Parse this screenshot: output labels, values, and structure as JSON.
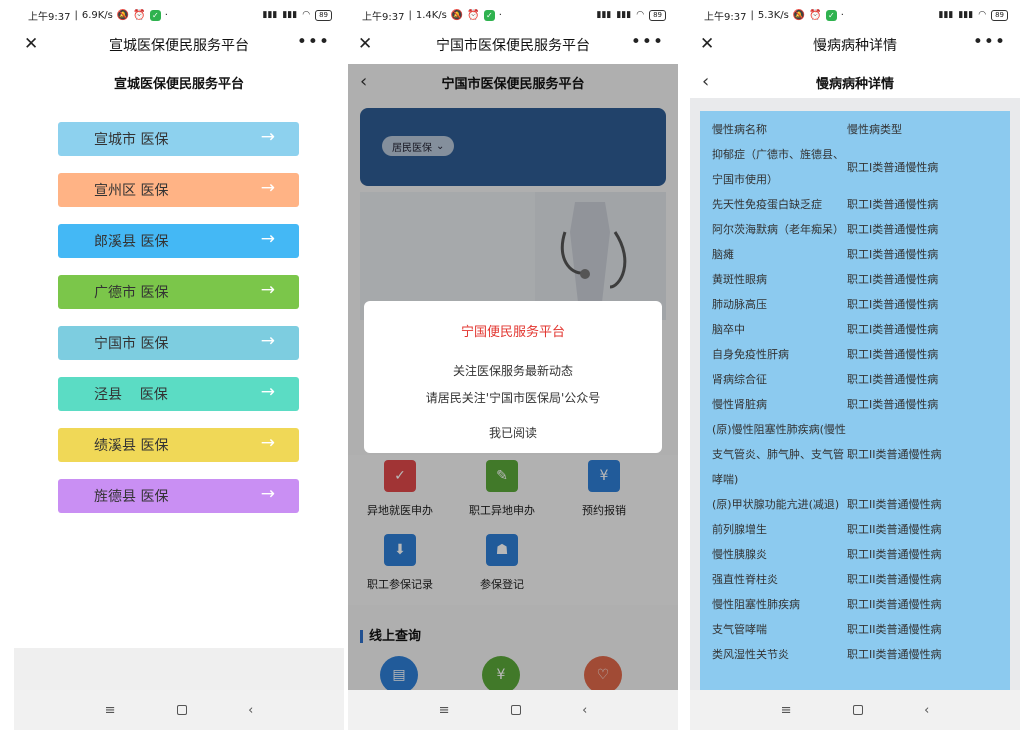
{
  "status": [
    {
      "time": "上午9:37",
      "speed": "6.9K/s",
      "battery": "89"
    },
    {
      "time": "上午9:37",
      "speed": "1.4K/s",
      "battery": "89"
    },
    {
      "time": "上午9:37",
      "speed": "5.3K/s",
      "battery": "89"
    }
  ],
  "panel1": {
    "title": "宣城医保便民服务平台",
    "subtitle": "宣城医保便民服务平台",
    "buttons": [
      {
        "label": "宣城市 医保",
        "color": "#8dd1ee"
      },
      {
        "label": "宣州区 医保",
        "color": "#ffb385"
      },
      {
        "label": "郎溪县 医保",
        "color": "#44b8f5"
      },
      {
        "label": "广德市 医保",
        "color": "#7bc64a"
      },
      {
        "label": "宁国市 医保",
        "color": "#7dcde0"
      },
      {
        "label": "泾县    医保",
        "color": "#5bdcc4"
      },
      {
        "label": "绩溪县 医保",
        "color": "#f0d857"
      },
      {
        "label": "旌德县 医保",
        "color": "#c98ff3"
      }
    ]
  },
  "panel2": {
    "title": "宁国市医保便民服务平台",
    "subtitle": "宁国市医保便民服务平台",
    "pill": "居民医保",
    "dialog": {
      "title": "宁国便民服务平台",
      "line1": "关注医保服务最新动态",
      "line2": "请居民关注'宁国市医保局'公众号",
      "button": "我已阅读"
    },
    "services": [
      {
        "label": "异地就医申办",
        "color": "#e0494a"
      },
      {
        "label": "职工异地申办",
        "color": "#5aa83a"
      },
      {
        "label": "预约报销",
        "color": "#2e7fd6"
      },
      {
        "label": "职工参保记录",
        "color": "#2e7fd6"
      },
      {
        "label": "参保登记",
        "color": "#2e7fd6"
      }
    ],
    "section": "线上查询",
    "circles": [
      {
        "color": "#2e7fd6"
      },
      {
        "color": "#5aa83a"
      },
      {
        "color": "#e0694a"
      }
    ]
  },
  "panel3": {
    "title": "慢病病种详情",
    "subtitle": "慢病病种详情",
    "header": [
      "慢性病名称",
      "慢性病类型"
    ],
    "rows": [
      [
        "抑郁症（广德市、旌德县、宁国市使用）",
        "职工I类普通慢性病"
      ],
      [
        "先天性免疫蛋白缺乏症",
        "职工I类普通慢性病"
      ],
      [
        "阿尔茨海默病（老年痴呆）",
        "职工I类普通慢性病"
      ],
      [
        "脑瘫",
        "职工I类普通慢性病"
      ],
      [
        "黄斑性眼病",
        "职工I类普通慢性病"
      ],
      [
        "肺动脉高压",
        "职工I类普通慢性病"
      ],
      [
        "脑卒中",
        "职工I类普通慢性病"
      ],
      [
        "自身免疫性肝病",
        "职工I类普通慢性病"
      ],
      [
        "肾病综合征",
        "职工I类普通慢性病"
      ],
      [
        "慢性肾脏病",
        "职工I类普通慢性病"
      ],
      [
        "(原)慢性阻塞性肺疾病(慢性支气管炎、肺气肿、支气管哮喘)",
        "职工II类普通慢性病"
      ],
      [
        "(原)甲状腺功能亢进(减退)",
        "职工II类普通慢性病"
      ],
      [
        "前列腺增生",
        "职工II类普通慢性病"
      ],
      [
        "慢性胰腺炎",
        "职工II类普通慢性病"
      ],
      [
        "强直性脊柱炎",
        "职工II类普通慢性病"
      ],
      [
        "慢性阻塞性肺疾病",
        "职工II类普通慢性病"
      ],
      [
        "支气管哮喘",
        "职工II类普通慢性病"
      ],
      [
        "类风湿性关节炎",
        "职工II类普通慢性病"
      ]
    ]
  }
}
